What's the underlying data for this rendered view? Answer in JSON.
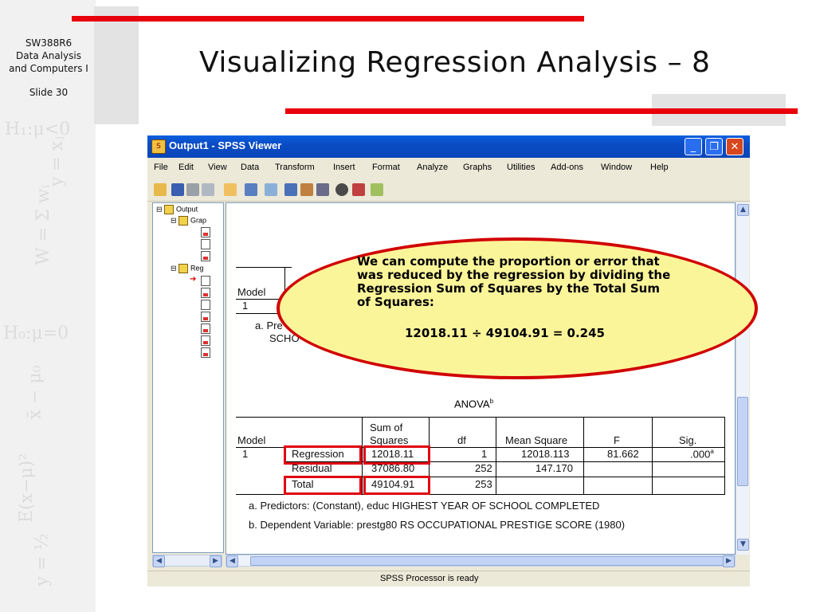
{
  "slide": {
    "course_code": "SW388R6",
    "course_name_line1": "Data Analysis",
    "course_name_line2": "and Computers I",
    "slide_number": "Slide 30",
    "title": "Visualizing Regression Analysis – 8",
    "accent_color": "#e8000b"
  },
  "window": {
    "title": "Output1 - SPSS Viewer",
    "menu": [
      "File",
      "Edit",
      "View",
      "Data",
      "Transform",
      "Insert",
      "Format",
      "Analyze",
      "Graphs",
      "Utilities",
      "Add-ons",
      "Window",
      "Help"
    ],
    "status": "SPSS Processor is ready"
  },
  "tree": {
    "root": "Output",
    "graph_node": "Grap",
    "regression_node": "Reg"
  },
  "model_summary": {
    "header": "Model",
    "row": "1",
    "footnote_a_prefix": "a. Pre",
    "footnote_a_cont": "SCHO"
  },
  "anova": {
    "title": "ANOVA",
    "title_sup": "b",
    "headers": {
      "model": "Model",
      "ss_line1": "Sum of",
      "ss_line2": "Squares",
      "df": "df",
      "ms": "Mean Square",
      "f": "F",
      "sig": "Sig."
    },
    "model_number": "1",
    "rows": [
      {
        "label": "Regression",
        "ss": "12018.11",
        "df": "1",
        "ms": "12018.113",
        "f": "81.662",
        "sig": ".000",
        "sig_sup": "a"
      },
      {
        "label": "Residual",
        "ss": "37086.80",
        "df": "252",
        "ms": "147.170",
        "f": "",
        "sig": "",
        "sig_sup": ""
      },
      {
        "label": "Total",
        "ss": "49104.91",
        "df": "253",
        "ms": "",
        "f": "",
        "sig": "",
        "sig_sup": ""
      }
    ],
    "footnote_a": "a. Predictors: (Constant), educ  HIGHEST YEAR OF SCHOOL COMPLETED",
    "footnote_b": "b. Dependent Variable: prestg80  RS OCCUPATIONAL PRESTIGE SCORE  (1980)"
  },
  "callout": {
    "text": "We can compute the proportion or error that was reduced by the regression by dividing the Regression Sum of Squares by the Total Sum of Squares:",
    "equation": "12018.11 ÷ 49104.91 = 0.245",
    "fill_color": "#fbf59a",
    "border_color": "#d10000"
  }
}
